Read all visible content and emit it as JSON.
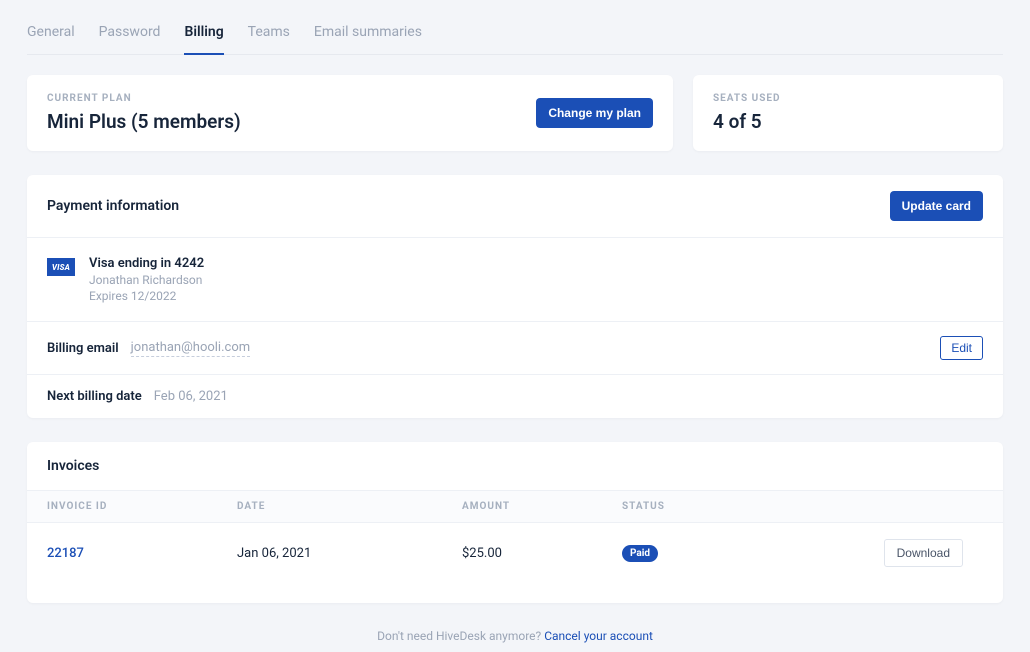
{
  "tabs": [
    "General",
    "Password",
    "Billing",
    "Teams",
    "Email summaries"
  ],
  "active_tab_index": 2,
  "plan": {
    "label": "CURRENT PLAN",
    "name": "Mini Plus (5 members)",
    "change_btn": "Change my plan"
  },
  "seats": {
    "label": "SEATS USED",
    "value": "4 of 5"
  },
  "payment": {
    "title": "Payment information",
    "update_btn": "Update card",
    "card_brand": "VISA",
    "card_summary": "Visa ending in 4242",
    "card_holder": "Jonathan Richardson",
    "card_expiry": "Expires 12/2022",
    "billing_email_label": "Billing email",
    "billing_email": "jonathan@hooli.com",
    "edit_btn": "Edit",
    "next_billing_label": "Next billing date",
    "next_billing": "Feb 06, 2021"
  },
  "invoices": {
    "title": "Invoices",
    "headers": {
      "id": "INVOICE ID",
      "date": "DATE",
      "amount": "AMOUNT",
      "status": "STATUS"
    },
    "rows": [
      {
        "id": "22187",
        "date": "Jan 06, 2021",
        "amount": "$25.00",
        "status": "Paid",
        "action": "Download"
      }
    ]
  },
  "footer": {
    "text": "Don't need HiveDesk anymore? ",
    "link": "Cancel your account"
  }
}
